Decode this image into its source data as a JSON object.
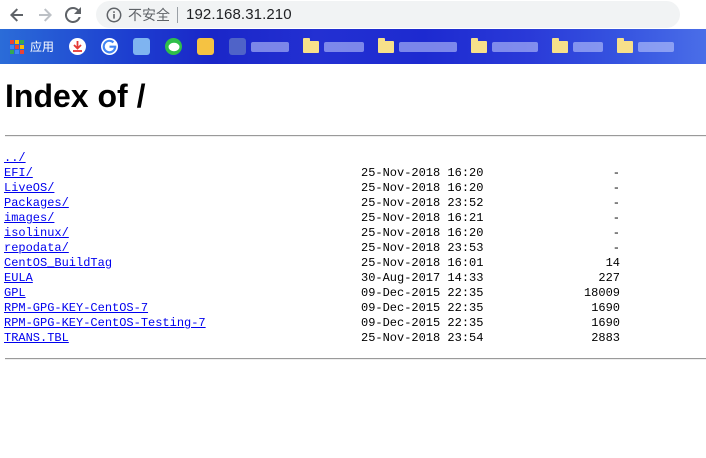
{
  "browser": {
    "security_label": "不安全",
    "url": "192.168.31.210",
    "bookmarks": {
      "apps_label": "应用"
    }
  },
  "page": {
    "title": "Index of /",
    "entries": [
      {
        "name": "../",
        "date": "",
        "size": ""
      },
      {
        "name": "EFI/",
        "date": "25-Nov-2018 16:20",
        "size": "-"
      },
      {
        "name": "LiveOS/",
        "date": "25-Nov-2018 16:20",
        "size": "-"
      },
      {
        "name": "Packages/",
        "date": "25-Nov-2018 23:52",
        "size": "-"
      },
      {
        "name": "images/",
        "date": "25-Nov-2018 16:21",
        "size": "-"
      },
      {
        "name": "isolinux/",
        "date": "25-Nov-2018 16:20",
        "size": "-"
      },
      {
        "name": "repodata/",
        "date": "25-Nov-2018 23:53",
        "size": "-"
      },
      {
        "name": "CentOS_BuildTag",
        "date": "25-Nov-2018 16:01",
        "size": "14"
      },
      {
        "name": "EULA",
        "date": "30-Aug-2017 14:33",
        "size": "227"
      },
      {
        "name": "GPL",
        "date": "09-Dec-2015 22:35",
        "size": "18009"
      },
      {
        "name": "RPM-GPG-KEY-CentOS-7",
        "date": "09-Dec-2015 22:35",
        "size": "1690"
      },
      {
        "name": "RPM-GPG-KEY-CentOS-Testing-7",
        "date": "09-Dec-2015 22:35",
        "size": "1690"
      },
      {
        "name": "TRANS.TBL",
        "date": "25-Nov-2018 23:54",
        "size": "2883"
      }
    ]
  }
}
